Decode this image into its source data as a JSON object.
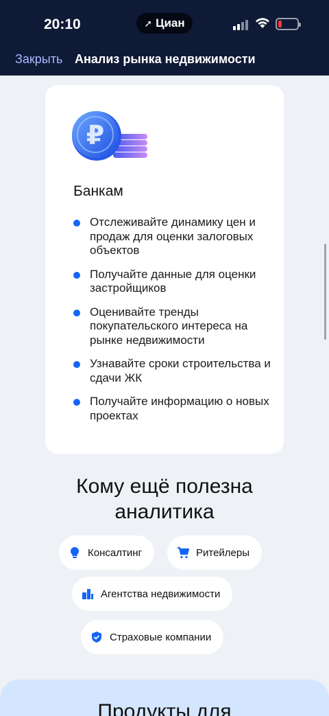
{
  "status": {
    "time": "20:10",
    "island_label": "Циан"
  },
  "nav": {
    "close_label": "Закрыть",
    "title": "Анализ рынка недвижимости"
  },
  "card": {
    "title": "Банкам",
    "bullets": [
      "Отслеживайте динамику цен и продаж для оценки залоговых объектов",
      "Получайте данные для оценки застройщиков",
      "Оценивайте тренды покупательского интереса на рынке недвижимости",
      "Узнавайте сроки строительства и сдачи ЖК",
      "Получайте информацию о новых проектах"
    ]
  },
  "section": {
    "title": "Кому ещё полезна аналитика",
    "chips": [
      {
        "label": "Консалтинг",
        "icon": "lightbulb-icon"
      },
      {
        "label": "Ритейлеры",
        "icon": "cart-icon"
      },
      {
        "label": "Агентства недвижимости",
        "icon": "buildings-icon"
      },
      {
        "label": "Страховые компании",
        "icon": "shield-check-icon"
      }
    ]
  },
  "bottom": {
    "title": "Продукты для"
  },
  "colors": {
    "accent": "#1565f5",
    "header": "#0f1a36",
    "background": "#eef1f6",
    "bottom_card": "#d4e6ff"
  }
}
